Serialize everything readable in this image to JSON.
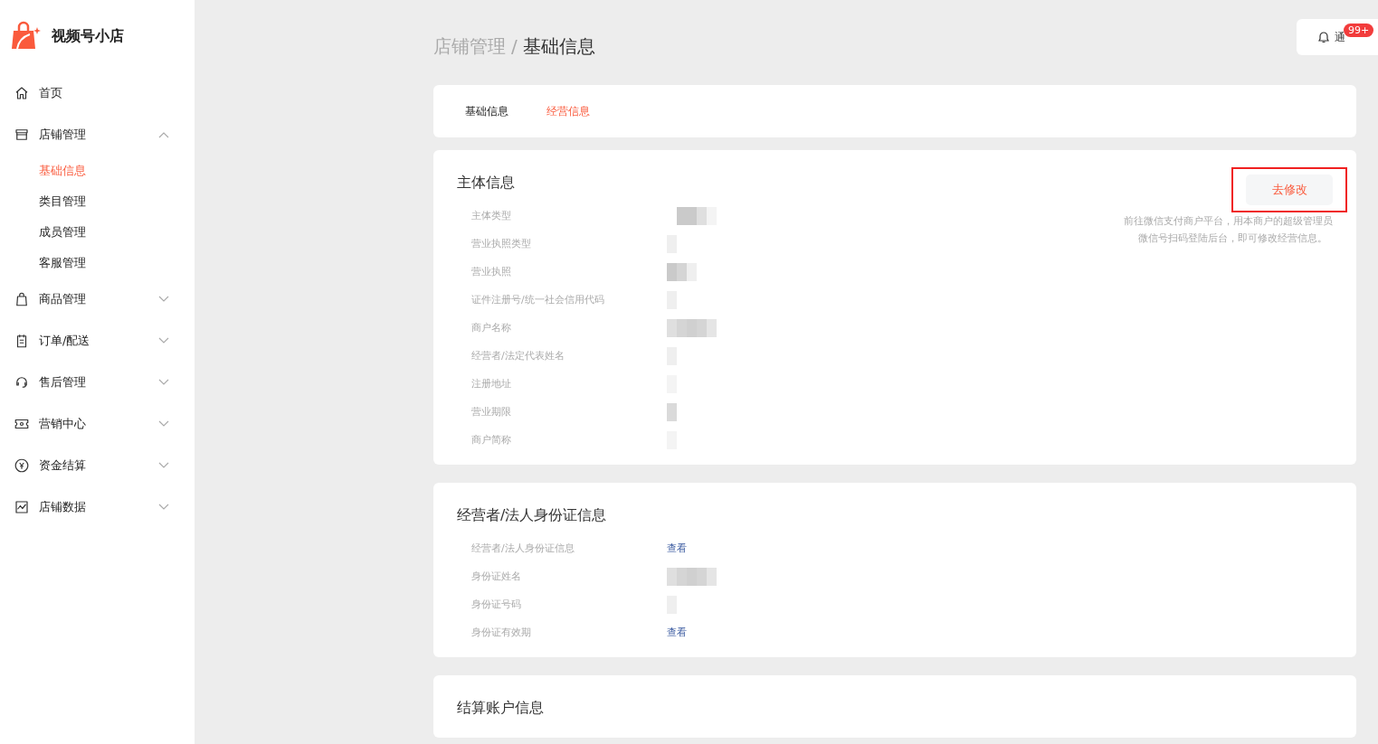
{
  "logo": {
    "title": "视频号小店"
  },
  "sidebar": {
    "items": [
      {
        "label": "首页"
      },
      {
        "label": "店铺管理",
        "expanded": true,
        "children": [
          {
            "label": "基础信息",
            "selected": true
          },
          {
            "label": "类目管理",
            "selected": false
          },
          {
            "label": "成员管理",
            "selected": false
          },
          {
            "label": "客服管理",
            "selected": false
          }
        ]
      },
      {
        "label": "商品管理",
        "expanded": false
      },
      {
        "label": "订单/配送",
        "expanded": false
      },
      {
        "label": "售后管理",
        "expanded": false
      },
      {
        "label": "营销中心",
        "expanded": false
      },
      {
        "label": "资金结算",
        "expanded": false
      },
      {
        "label": "店铺数据",
        "expanded": false
      }
    ]
  },
  "breadcrumb": {
    "parent": "店铺管理",
    "separator": "/",
    "current": "基础信息"
  },
  "notification": {
    "label": "通",
    "badge": "99+"
  },
  "tabs": [
    {
      "label": "基础信息",
      "selected": false
    },
    {
      "label": "经营信息",
      "selected": true
    }
  ],
  "sections": [
    {
      "title": "主体信息",
      "action": {
        "label": "去修改",
        "highlighted": true,
        "hint": [
          "前往微信支付商户平台，用本商户的超级管理员",
          "微信号扫码登陆后台，即可修改经营信息。"
        ]
      },
      "fields": [
        {
          "label": "主体类型",
          "kind": "redacted"
        },
        {
          "label": "营业执照类型",
          "kind": "redacted"
        },
        {
          "label": "营业执照",
          "kind": "redacted"
        },
        {
          "label": "证件注册号/统一社会信用代码",
          "kind": "redacted"
        },
        {
          "label": "商户名称",
          "kind": "redacted"
        },
        {
          "label": "经营者/法定代表姓名",
          "kind": "redacted"
        },
        {
          "label": "注册地址",
          "kind": "redacted"
        },
        {
          "label": "营业期限",
          "kind": "redacted"
        },
        {
          "label": "商户简称",
          "kind": "redacted"
        }
      ]
    },
    {
      "title": "经营者/法人身份证信息",
      "fields": [
        {
          "label": "经营者/法人身份证信息",
          "kind": "link",
          "value": "查看"
        },
        {
          "label": "身份证姓名",
          "kind": "redacted"
        },
        {
          "label": "身份证号码",
          "kind": "redacted"
        },
        {
          "label": "身份证有效期",
          "kind": "link",
          "value": "查看"
        }
      ]
    },
    {
      "title": "结算账户信息"
    }
  ]
}
